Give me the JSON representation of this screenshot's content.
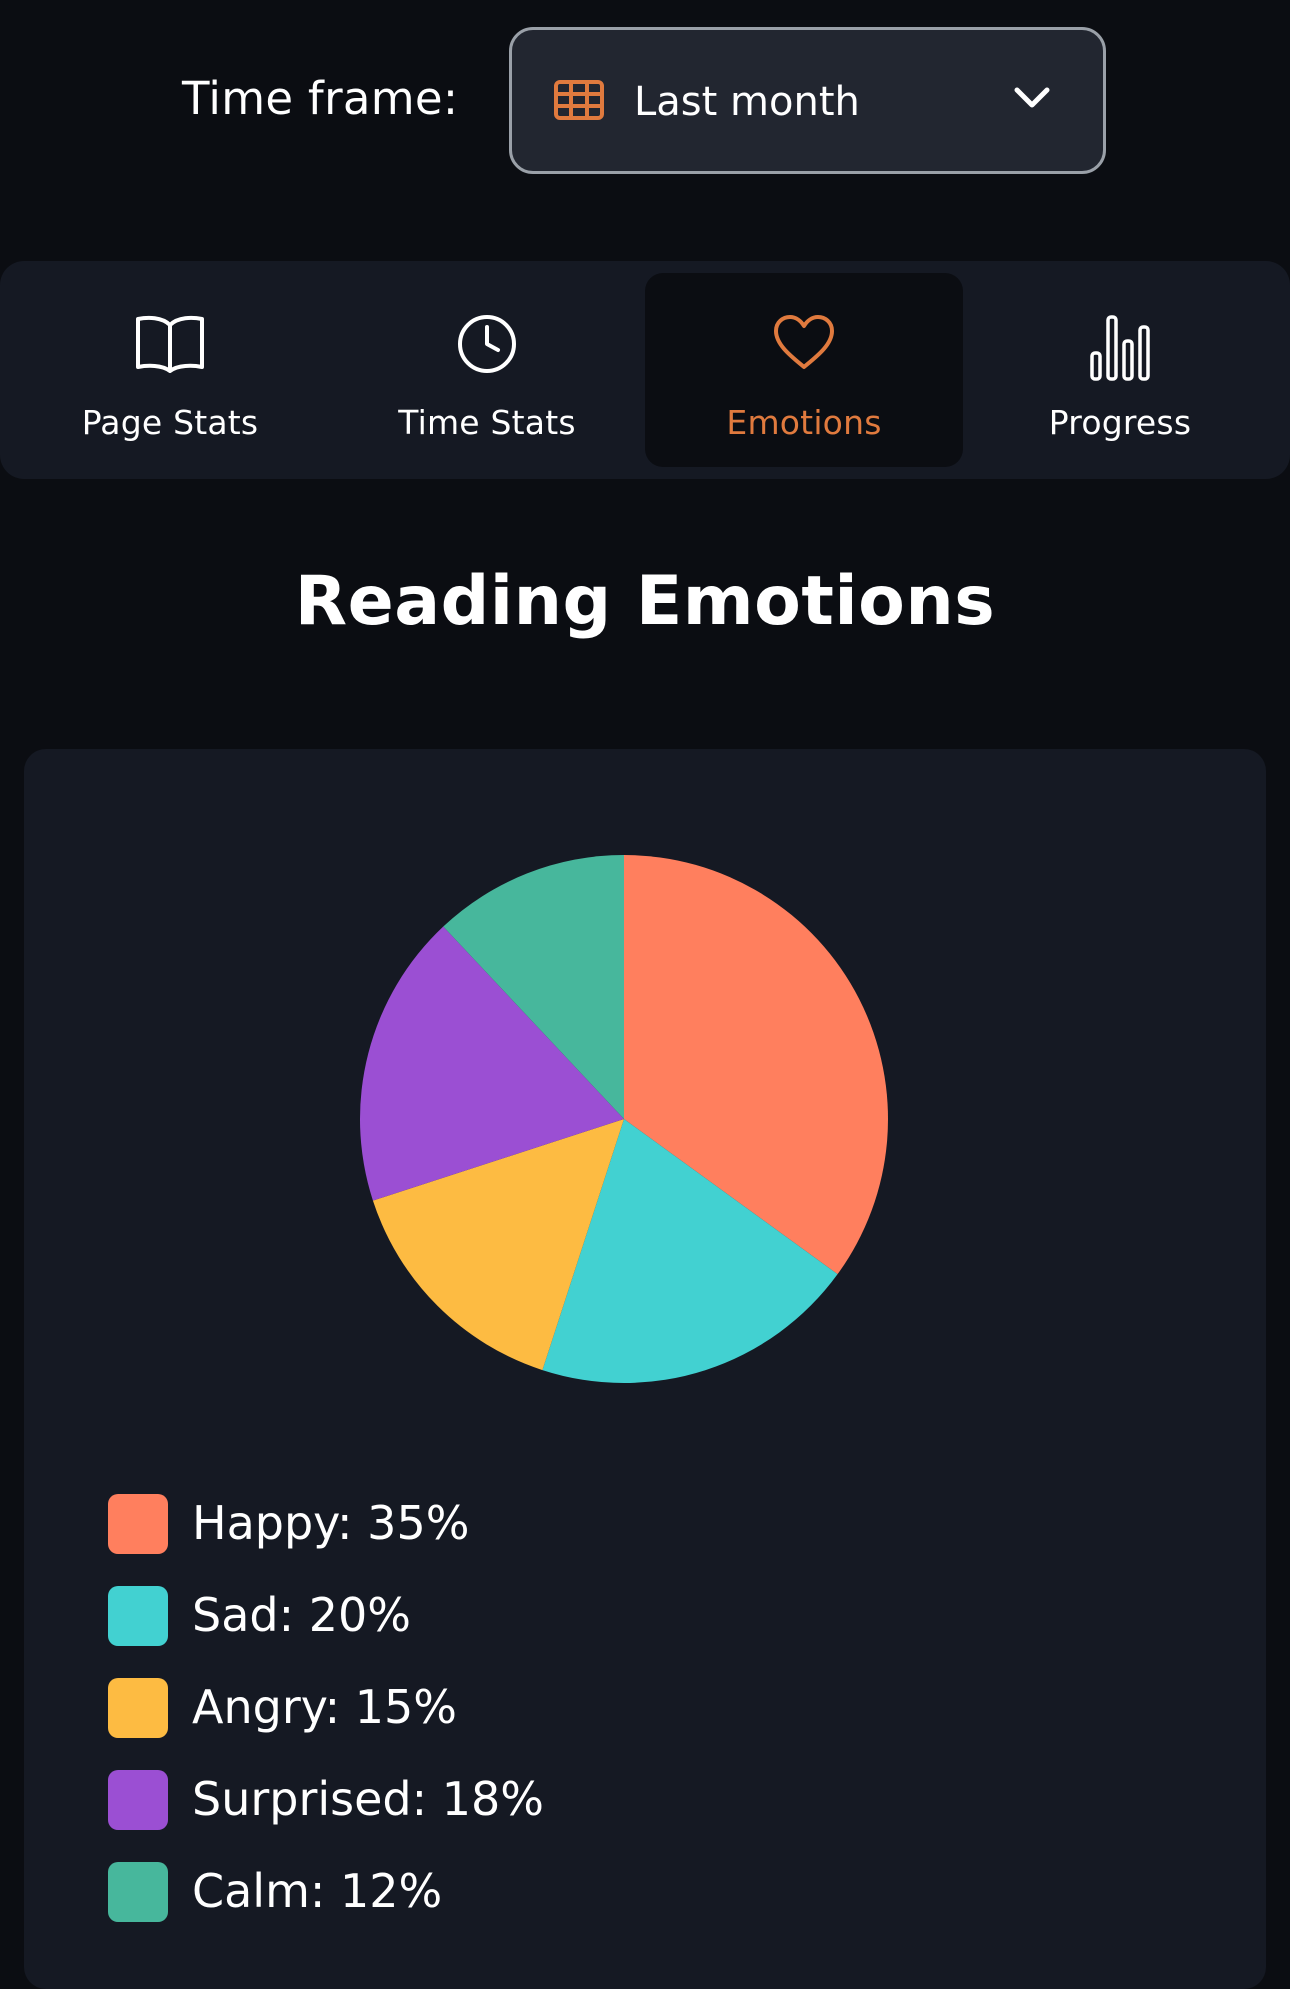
{
  "toolbar": {
    "time_frame_label": "Time frame:",
    "time_frame_value": "Last month",
    "calendar_icon": "calendar-grid-icon",
    "dropdown_icon": "chevron-down-icon"
  },
  "tabs": [
    {
      "label": "Page Stats",
      "icon": "book-open-icon",
      "active": false
    },
    {
      "label": "Time Stats",
      "icon": "clock-icon",
      "active": false
    },
    {
      "label": "Emotions",
      "icon": "heart-icon",
      "active": true
    },
    {
      "label": "Progress",
      "icon": "bar-chart-icon",
      "active": false
    }
  ],
  "main": {
    "title": "Reading Emotions"
  },
  "legend": [
    {
      "text": "Happy: 35%"
    },
    {
      "text": "Sad: 20%"
    },
    {
      "text": "Angry: 15%"
    },
    {
      "text": "Surprised: 18%"
    },
    {
      "text": "Calm: 12%"
    }
  ],
  "colors": {
    "accent": "#e07a3e",
    "background": "#0b0d12",
    "panel": "#151923"
  },
  "chart_data": {
    "type": "pie",
    "title": "Reading Emotions",
    "categories": [
      "Happy",
      "Sad",
      "Angry",
      "Surprised",
      "Calm"
    ],
    "values": [
      35,
      20,
      15,
      18,
      12
    ],
    "colors": [
      "#ff7f5e",
      "#42d1d1",
      "#fdbb42",
      "#9b4fd3",
      "#47b79c"
    ],
    "legend_position": "bottom"
  }
}
